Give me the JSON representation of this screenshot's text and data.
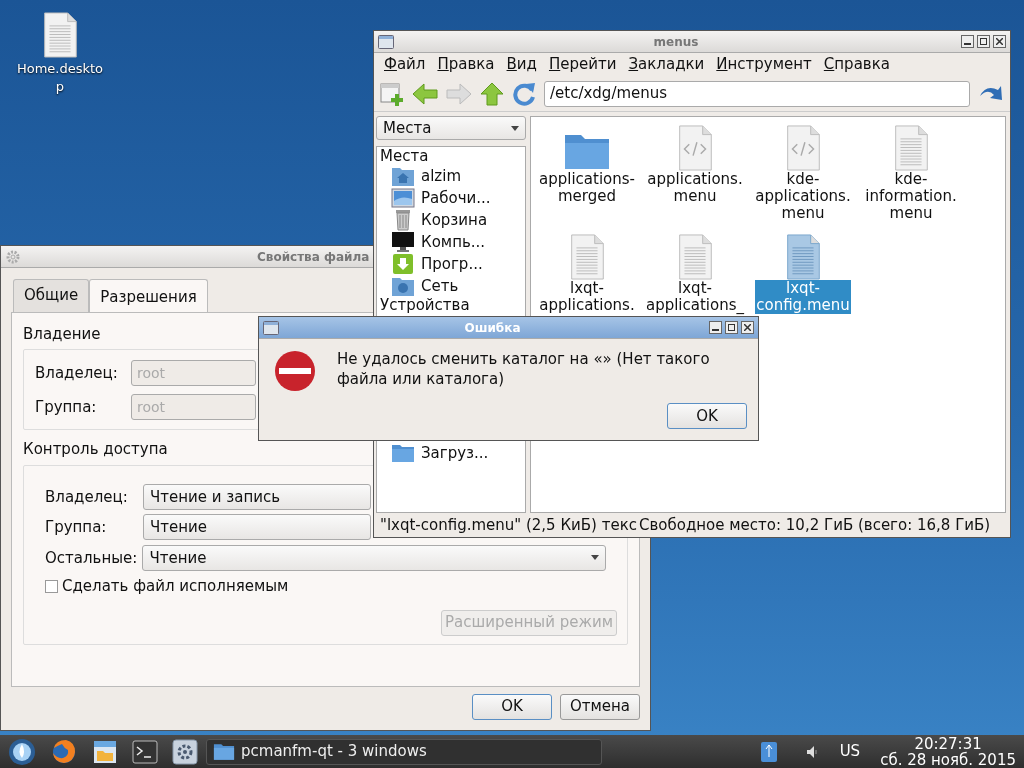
{
  "desktop_icons": [
    {
      "label": "Home.desktop"
    }
  ],
  "file_properties": {
    "title": "Свойства файла",
    "tabs": [
      {
        "label": "Общие",
        "selected": false
      },
      {
        "label": "Разрешения",
        "selected": true
      }
    ],
    "ownership": {
      "heading": "Владение",
      "rows": [
        {
          "label": "Владелец:",
          "value": "root",
          "disabled": true
        },
        {
          "label": "Группа:",
          "value": "root",
          "disabled": true
        }
      ]
    },
    "access": {
      "heading": "Контроль доступа",
      "rows": [
        {
          "label": "Владелец:",
          "value": "Чтение и запись"
        },
        {
          "label": "Группа:",
          "value": "Чтение"
        },
        {
          "label": "Остальные:",
          "value": "Чтение"
        }
      ],
      "executable": {
        "label": "Сделать файл исполняемым",
        "checked": false
      },
      "advanced_button": {
        "label": "Расширенный режим",
        "disabled": true
      }
    },
    "buttons": [
      {
        "label": "OK",
        "default": true
      },
      {
        "label": "Отмена",
        "default": false
      }
    ]
  },
  "file_manager": {
    "title": "menus",
    "menu": [
      "Файл",
      "Правка",
      "Вид",
      "Перейти",
      "Закладки",
      "Инструмент",
      "Справка"
    ],
    "path": "/etc/xdg/menus",
    "side_pane_selector": "Места",
    "sidebar": [
      {
        "heading": "Места",
        "items": [
          {
            "label": "alzim",
            "kind": "home"
          },
          {
            "label": "Рабочи...",
            "kind": "desktop"
          },
          {
            "label": "Корзина",
            "kind": "trash"
          },
          {
            "label": "Компь...",
            "kind": "computer"
          },
          {
            "label": "Прогр...",
            "kind": "apps"
          },
          {
            "label": "Сеть",
            "kind": "network"
          }
        ]
      },
      {
        "heading": "Устройства"
      }
    ],
    "bookmarks": [
      {
        "label": "Загруз...",
        "kind": "folder"
      }
    ],
    "files": [
      {
        "label_lines": [
          "applications-",
          "merged"
        ],
        "kind": "folder",
        "selected": false
      },
      {
        "label_lines": [
          "applications.",
          "menu"
        ],
        "kind": "code",
        "selected": false
      },
      {
        "label_lines": [
          "kde-",
          "applications.",
          "menu"
        ],
        "kind": "code",
        "selected": false
      },
      {
        "label_lines": [
          "kde-",
          "information.",
          "menu"
        ],
        "kind": "text",
        "selected": false
      },
      {
        "label_lines": [
          "lxqt-",
          "applications."
        ],
        "kind": "text",
        "selected": false
      },
      {
        "label_lines": [
          "lxqt-",
          "applications_"
        ],
        "kind": "text",
        "selected": false
      },
      {
        "label_lines": [
          "lxqt-",
          "config.menu"
        ],
        "kind": "text",
        "selected": true
      }
    ],
    "status_bar": [
      "\"lxqt-config.menu\" (2,5 КиБ) текс",
      "Свободное место: 10,2 ГиБ (всего: 16,8 ГиБ)"
    ]
  },
  "error_dialog": {
    "title": "Ошибка",
    "message": "Не удалось сменить каталог на «» (Нет такого файла или каталога)",
    "button": "OK"
  },
  "taskbar": {
    "task": "pcmanfm-qt - 3 windows",
    "keyboard_layout": "US",
    "time": "20:27:31",
    "date": "сб. 28 нояб. 2015"
  }
}
